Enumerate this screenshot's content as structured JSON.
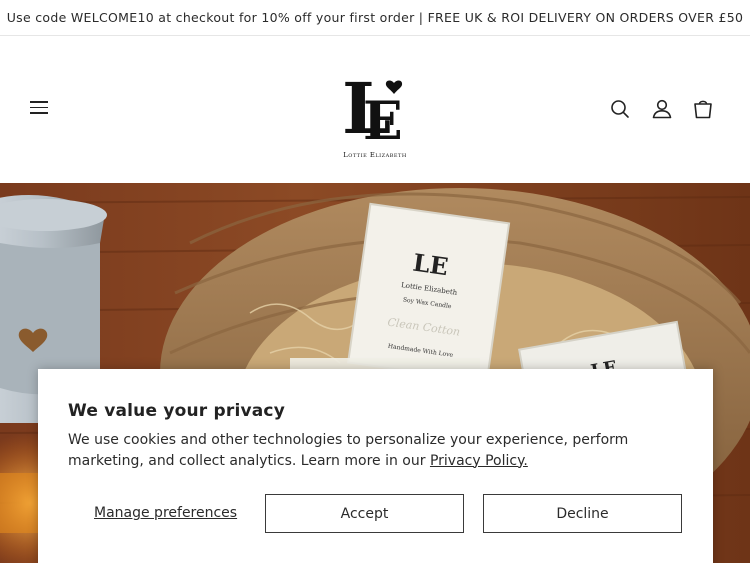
{
  "announcement": {
    "text": "Use code WELCOME10 at checkout for 10% off your first order | FREE UK & ROI DELIVERY ON ORDERS OVER £50"
  },
  "header": {
    "logo_text": "Lottie Elizabeth",
    "icons": [
      "menu-icon",
      "search-icon",
      "account-icon",
      "cart-icon"
    ]
  },
  "hero": {
    "product_labels": {
      "brand": "Lottie Elizabeth",
      "type": "Soy Wax Candle",
      "scent": "Clean Cotton",
      "tagline": "Handmade With Love"
    }
  },
  "cookie_banner": {
    "title": "We value your privacy",
    "body_text": "We use cookies and other technologies to personalize your experience, perform marketing, and collect analytics. Learn more in our ",
    "policy_link": "Privacy Policy.",
    "manage_label": "Manage preferences",
    "accept_label": "Accept",
    "decline_label": "Decline"
  }
}
